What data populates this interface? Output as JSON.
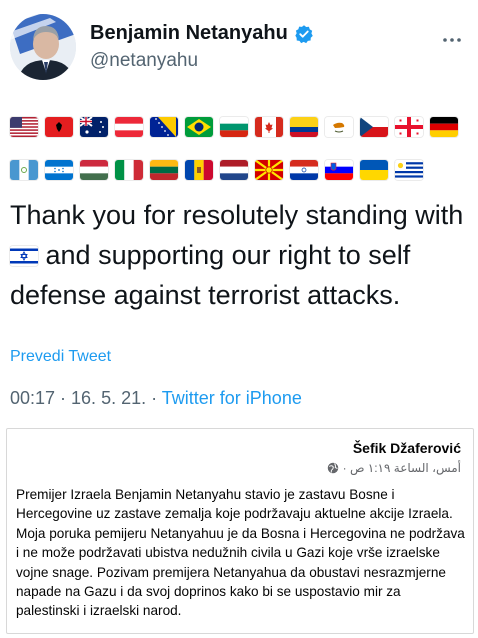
{
  "tweet": {
    "display_name": "Benjamin Netanyahu",
    "handle": "@netanyahu",
    "verified_icon": "verified-badge-icon",
    "more_icon": "more-icon",
    "flags_row1": [
      "United States",
      "Albania",
      "Australia",
      "Austria",
      "Bosnia and Herzegovina",
      "Brazil",
      "Bulgaria",
      "Canada",
      "Colombia",
      "Cyprus",
      "Czech Republic",
      "Georgia",
      "Germany"
    ],
    "flags_row2": [
      "Guatemala",
      "Honduras",
      "Hungary",
      "Italy",
      "Lithuania",
      "Moldova",
      "Netherlands",
      "North Macedonia",
      "Paraguay",
      "Slovenia",
      "Ukraine",
      "Uruguay"
    ],
    "text_before_flag": "Thank you for resolutely standing with",
    "inline_flag": "Israel",
    "text_after_flag": "and supporting our right to self defense against terrorist attacks.",
    "translate_label": "Prevedi Tweet",
    "timestamp": "00:17 · 16. 5. 21. · ",
    "source": "Twitter for iPhone"
  },
  "fb_post": {
    "author": "Šefik Džaferović",
    "time": "أمس، الساعة ١:١٩ ص ·",
    "globe_icon": "globe-icon",
    "body": "Premijer Izraela Benjamin Netanyahu stavio je zastavu Bosne i Hercegovine uz zastave zemalja koje podržavaju aktuelne akcije Izraela. Moja poruka pemijeru Netanyahuu je da Bosna i Hercegovina ne podržava i ne može podržavati ubistva nedužnih civila u Gazi koje vrše izraelske vojne snage. Pozivam premijera Netanyahua da obustavi nesrazmjerne napade na Gazu i da svoj doprinos kako bi se uspostavio mir za palestinski i izraelski narod."
  },
  "colors": {
    "link_blue": "#1d9bf0",
    "secondary_text": "#536471",
    "primary_text": "#0f1419"
  }
}
